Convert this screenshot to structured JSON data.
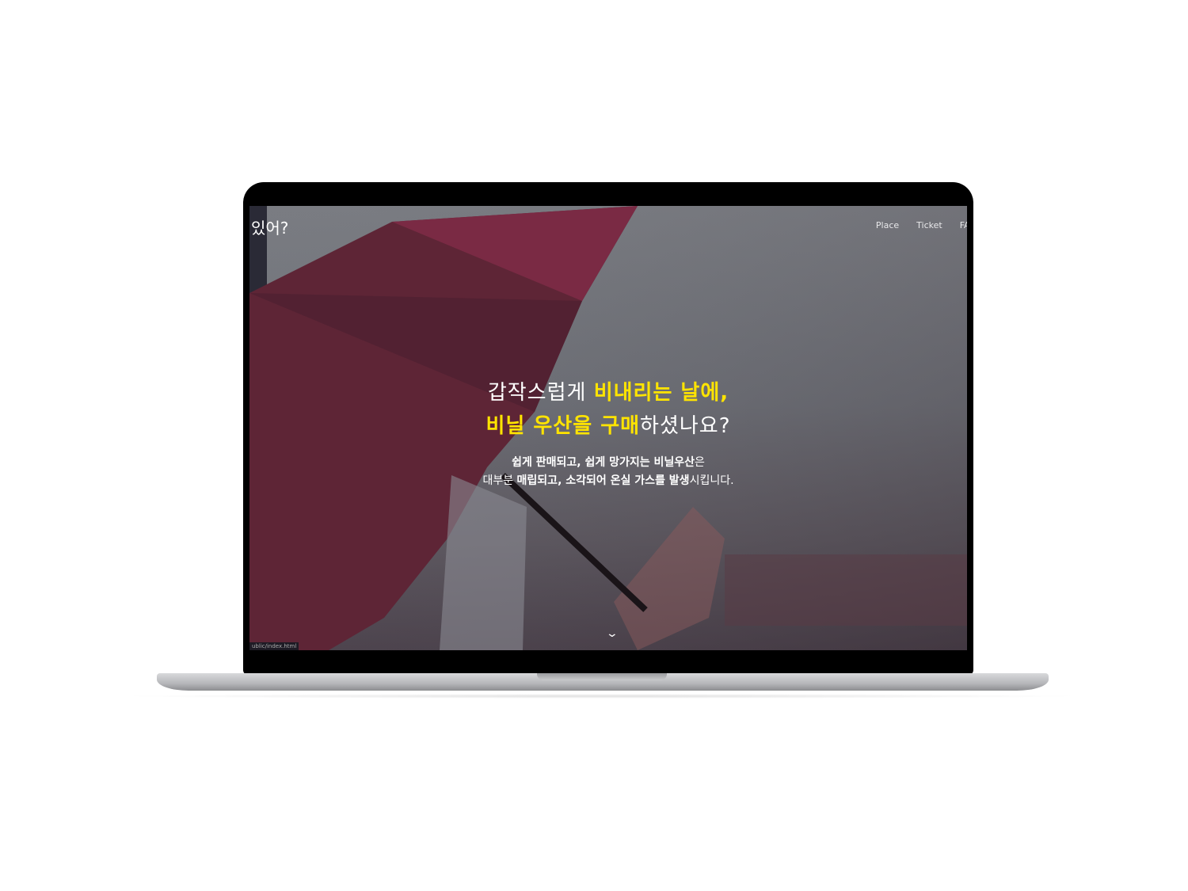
{
  "site": {
    "logo": "있어?",
    "nav": [
      "Place",
      "Ticket",
      "FAQ"
    ]
  },
  "hero": {
    "line1_plain": "갑작스럽게 ",
    "line1_highlight": "비내리는 날에,",
    "line2_highlight": "비닐 우산을 구매",
    "line2_plain": "하셨나요?",
    "sub1_bold": "쉽게 판매되고, 쉽게 망가지는 비닐우산",
    "sub1_plain": "은",
    "sub2_a": "대부분 ",
    "sub2_bold1": "매립되고, 소각되어 온실 가스를 발생",
    "sub2_b": "시킵니다."
  },
  "scroll_icon": "chevron-down-icon",
  "status_bar": "ublic/index.html",
  "colors": {
    "highlight": "#ffe400"
  }
}
